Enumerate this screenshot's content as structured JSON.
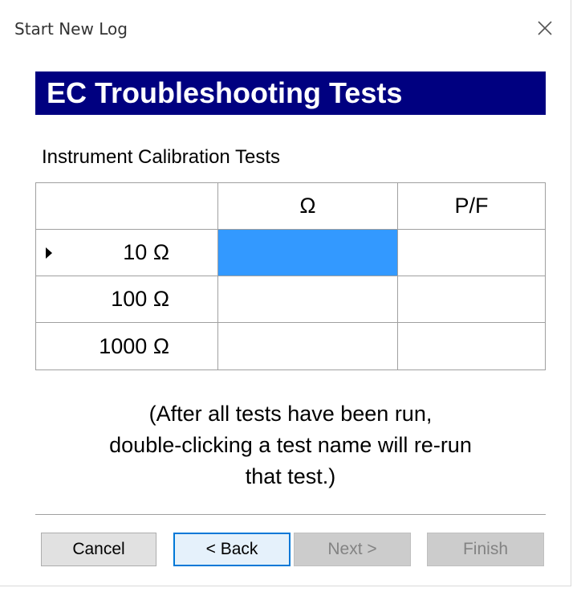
{
  "window": {
    "title": "Start New Log",
    "close_glyph": "✕"
  },
  "header": {
    "title": "EC Troubleshooting Tests",
    "band_color": "#000080"
  },
  "section": {
    "label": "Instrument Calibration Tests"
  },
  "table": {
    "columns": [
      "",
      "Ω",
      "P/F"
    ],
    "rows": [
      {
        "name": "10 Ω",
        "ohms": "",
        "pf": "",
        "current": true,
        "selected_cell": "ohms"
      },
      {
        "name": "100 Ω",
        "ohms": "",
        "pf": ""
      },
      {
        "name": "1000 Ω",
        "ohms": "",
        "pf": ""
      }
    ],
    "selection_color": "#3399ff"
  },
  "note": {
    "line1": "(After all tests have been run,",
    "line2": "double-clicking a test name will re-run",
    "line3": "that test.)"
  },
  "buttons": {
    "cancel": "Cancel",
    "back": "< Back",
    "next": "Next >",
    "finish": "Finish"
  }
}
